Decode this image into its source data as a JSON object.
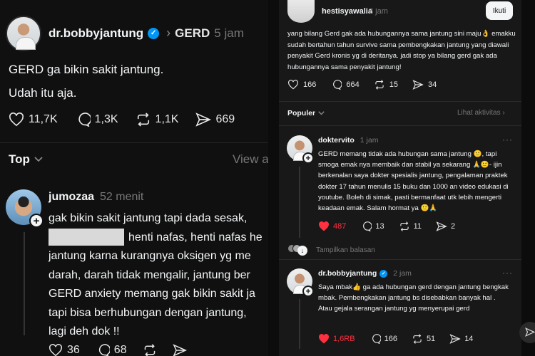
{
  "left_post": {
    "username": "dr.bobbyjantung",
    "separator": "›",
    "topic": "GERD",
    "time": "5 jam",
    "line1": "GERD ga bikin sakit jantung.",
    "line2": "Udah itu aja.",
    "likes": "11,7K",
    "replies": "1,3K",
    "reposts": "1,1K",
    "shares": "669"
  },
  "left_sort": {
    "label": "Top",
    "view_activity": "View a"
  },
  "left_reply": {
    "username": "jumozaa",
    "time": "52 menit",
    "lines": [
      "gak bikin sakit jantung tapi dada sesak,",
      "henti nafas, henti nafas he",
      "jantung karna kurangnya oksigen yg me",
      "darah, darah tidak mengalir, jantung ber",
      "GERD anxiety memang gak bikin sakit ja",
      "tapi bisa berhubungan dengan jantung,",
      "lagi deh dok !!"
    ],
    "likes": "36",
    "replies": "68"
  },
  "right_top": {
    "username": "hestisyawalia",
    "time": "3 jam",
    "follow_label": "Ikuti",
    "text": "yang bilang Gerd gak ada hubungannya sama jantung sini maju👌 emakku sudah bertahun tahun survive sama pembengkakan jantung yang diawali penyakit Gerd kronis yg di deritanya. jadi stop ya bilang gerd gak ada hubungannya sama penyakit jantung!",
    "likes": "166",
    "replies": "664",
    "reposts": "15",
    "shares": "34"
  },
  "right_sort": {
    "label": "Populer",
    "activity": "Lihat aktivitas ›"
  },
  "comment1": {
    "username": "doktervito",
    "time": "1 jam",
    "text": "GERD memang tidak ada hubungan sama jantung 🙂, tapi smoga emak nya membaik dan stabil ya sekarang 🙏🙂- ijin berkenalan saya dokter spesialis jantung, pengalaman praktek dokter 17 tahun menulis 15 buku dan 1000 an video edukasi di youtube. Boleh di simak, pasti bermanfaat utk lebih mengerti keadaan emak. Salam hormat ya 🙂🙏",
    "likes": "487",
    "replies": "13",
    "reposts": "11",
    "shares": "2",
    "show_replies": "Tampilkan balasan"
  },
  "comment2": {
    "username": "dr.bobbyjantung",
    "time": "2 jam",
    "text": "Saya mbak👍 ga ada hubungan gerd dengan jantung bengkak mbak.  Pembengkakan jantung bs disebabkan banyak hal . Atau gejala serangan jantung yg menyerupai gerd",
    "likes": "1,6RB",
    "replies": "166",
    "reposts": "51",
    "shares": "14"
  },
  "more_glyph": "···",
  "colors": {
    "background": "#101010",
    "panel": "#181818",
    "verified": "#0095f6",
    "like_red": "#ff3040",
    "muted": "#777777"
  }
}
